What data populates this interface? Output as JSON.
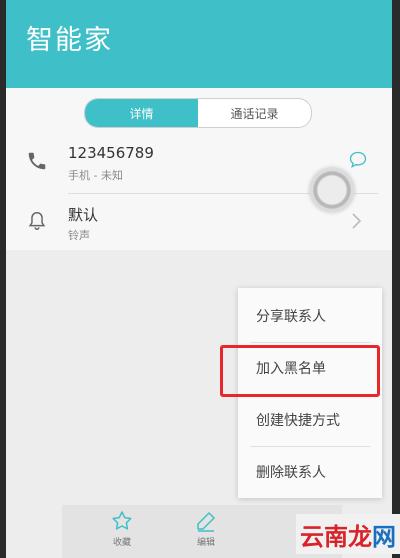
{
  "header": {
    "title": "智能家"
  },
  "tabs": [
    {
      "label": "详情",
      "active": true
    },
    {
      "label": "通话记录",
      "active": false
    }
  ],
  "contact": {
    "phone_number": "123456789",
    "phone_type": "手机 - 未知",
    "ringtone_title": "默认",
    "ringtone_label": "铃声"
  },
  "menu": {
    "items": [
      {
        "label": "分享联系人"
      },
      {
        "label": "加入黑名单",
        "highlighted": true
      },
      {
        "label": "创建快捷方式"
      },
      {
        "label": "删除联系人"
      }
    ]
  },
  "bottom_bar": {
    "favorite_label": "收藏",
    "edit_label": "编辑"
  },
  "watermark": {
    "chars": [
      "云",
      "南",
      "龙",
      "网"
    ],
    "colors": [
      "#d8232a",
      "#d8232a",
      "#d8232a",
      "#1a6fbf"
    ]
  },
  "colors": {
    "accent": "#3fbfc7",
    "highlight": "#e8262b"
  }
}
